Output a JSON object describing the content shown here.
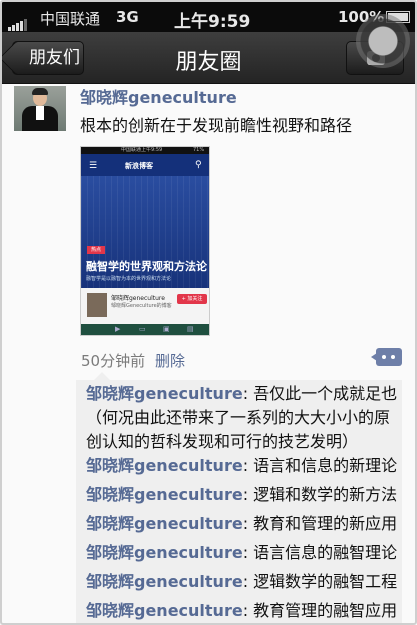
{
  "status_bar": {
    "carrier": "中国联通",
    "network": "3G",
    "time": "上午9:59",
    "battery": "100%"
  },
  "nav": {
    "back_label": "朋友们",
    "title": "朋友圈"
  },
  "post": {
    "author": "邹晓辉geneculture",
    "text": "根本的创新在于发现前瞻性视野和路径",
    "time": "50分钟前",
    "delete_label": "删除",
    "thumbnail": {
      "status_left": "中国联通",
      "status_time": "上午9:59",
      "status_right": "71%",
      "site_name": "新浪博客",
      "tag": "热点",
      "headline": "融智学的世界观和方法论",
      "subline": "融智学是以融智为本的世界观和方法论",
      "card_name": "邹晓辉geneculture",
      "card_sub": "邹晓辉Geneculture的博客",
      "card_follow": "+ 加关注"
    }
  },
  "comments": [
    {
      "author": "邹晓辉geneculture",
      "text": ": 吾仅此一个成就足也（何况由此还带来了一系列的大大小小的原创认知的哲科发现和可行的技艺发明）"
    },
    {
      "author": "邹晓辉geneculture",
      "text": ": 语言和信息的新理论"
    },
    {
      "author": "邹晓辉geneculture",
      "text": ": 逻辑和数学的新方法"
    },
    {
      "author": "邹晓辉geneculture",
      "text": ": 教育和管理的新应用"
    },
    {
      "author": "邹晓辉geneculture",
      "text": ": 语言信息的融智理论"
    },
    {
      "author": "邹晓辉geneculture",
      "text": ": 逻辑数学的融智工程"
    },
    {
      "author": "邹晓辉geneculture",
      "text": ": 教育管理的融智应用"
    }
  ]
}
